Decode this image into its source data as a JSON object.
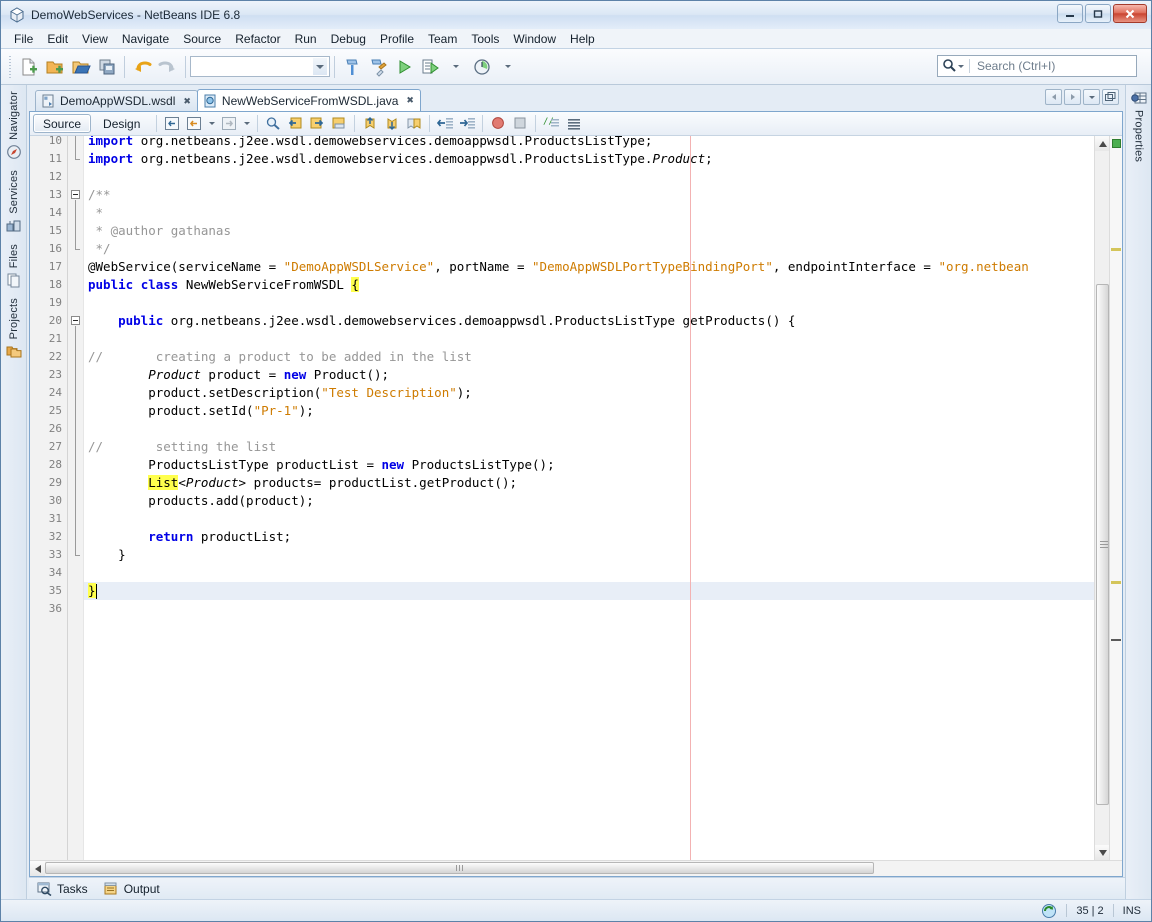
{
  "window": {
    "title": "DemoWebServices - NetBeans IDE 6.8",
    "icon": "netbeans-cube-icon",
    "controls": {
      "minimize": "–",
      "maximize": "❐",
      "close": "✕"
    }
  },
  "menubar": {
    "items": [
      {
        "label": "File"
      },
      {
        "label": "Edit"
      },
      {
        "label": "View"
      },
      {
        "label": "Navigate"
      },
      {
        "label": "Source"
      },
      {
        "label": "Refactor"
      },
      {
        "label": "Run"
      },
      {
        "label": "Debug"
      },
      {
        "label": "Profile"
      },
      {
        "label": "Team"
      },
      {
        "label": "Tools"
      },
      {
        "label": "Window"
      },
      {
        "label": "Help"
      }
    ]
  },
  "toolbar": {
    "buttons": [
      {
        "name": "new-file-button",
        "icon": "new-file-icon"
      },
      {
        "name": "new-project-button",
        "icon": "new-project-icon"
      },
      {
        "name": "open-project-button",
        "icon": "open-project-icon"
      },
      {
        "name": "save-all-button",
        "icon": "save-all-icon"
      },
      {
        "name": "undo-button",
        "icon": "undo-arrow-icon"
      },
      {
        "name": "redo-button",
        "icon": "redo-arrow-icon"
      }
    ],
    "config_combo": {
      "value": "",
      "name": "configuration-combo"
    },
    "right_buttons": [
      {
        "name": "build-project-button",
        "icon": "hammer-icon"
      },
      {
        "name": "clean-and-build-button",
        "icon": "hammer-broom-icon"
      },
      {
        "name": "run-project-button",
        "icon": "green-play-icon"
      },
      {
        "name": "debug-project-button",
        "icon": "debug-icon"
      },
      {
        "name": "profile-project-button",
        "icon": "profile-clock-icon"
      }
    ]
  },
  "search": {
    "placeholder": "Search (Ctrl+I)",
    "value": "",
    "icon": "search-magnifier-icon"
  },
  "left_rail": {
    "tabs": [
      {
        "label": "Navigator",
        "icon": "navigator-compass-icon"
      },
      {
        "label": "Services",
        "icon": "services-server-icon"
      },
      {
        "label": "Files",
        "icon": "files-pages-icon"
      },
      {
        "label": "Projects",
        "icon": "projects-folder-icon"
      }
    ]
  },
  "right_rail": {
    "tabs": [
      {
        "label": "Properties",
        "icon": "properties-grid-icon"
      }
    ]
  },
  "document_tabs": {
    "tabs": [
      {
        "label": "DemoAppWSDL.wsdl",
        "icon": "wsdl-file-icon",
        "active": false,
        "close": "✖"
      },
      {
        "label": "NewWebServiceFromWSDL.java",
        "icon": "java-file-icon",
        "active": true,
        "close": "✖"
      }
    ],
    "nav": [
      {
        "name": "scroll-tabs-left-button",
        "icon": "chevron-left-icon"
      },
      {
        "name": "scroll-tabs-right-button",
        "icon": "chevron-right-icon"
      },
      {
        "name": "show-opened-documents-button",
        "icon": "chevron-down-icon"
      },
      {
        "name": "maximize-window-button",
        "icon": "maximize-window-icon"
      }
    ]
  },
  "editor_toolbar": {
    "view_buttons": [
      {
        "label": "Source",
        "selected": true
      },
      {
        "label": "Design",
        "selected": false
      }
    ],
    "action_buttons": [
      {
        "name": "last-edit-button",
        "icon": "last-edit-icon"
      },
      {
        "name": "back-button",
        "icon": "back-arrow-icon"
      },
      {
        "name": "back-dropdown",
        "icon": "chevron-down-icon"
      },
      {
        "name": "forward-button",
        "icon": "forward-arrow-icon"
      },
      {
        "name": "forward-dropdown",
        "icon": "chevron-down-icon"
      },
      {
        "name": "find-selection-button",
        "icon": "find-magnifier-icon"
      },
      {
        "name": "find-previous-button",
        "icon": "find-previous-icon"
      },
      {
        "name": "find-next-button",
        "icon": "find-next-icon"
      },
      {
        "name": "toggle-highlight-button",
        "icon": "toggle-highlight-icon"
      },
      {
        "name": "previous-bookmark-button",
        "icon": "previous-bookmark-icon"
      },
      {
        "name": "next-bookmark-button",
        "icon": "next-bookmark-icon"
      },
      {
        "name": "toggle-bookmark-button",
        "icon": "toggle-bookmark-icon"
      },
      {
        "name": "shift-left-button",
        "icon": "shift-left-icon"
      },
      {
        "name": "shift-right-button",
        "icon": "shift-right-icon"
      },
      {
        "name": "start-macro-recording-button",
        "icon": "record-macro-icon"
      },
      {
        "name": "stop-macro-recording-button",
        "icon": "stop-macro-icon"
      },
      {
        "name": "comment-button",
        "icon": "comment-icon"
      },
      {
        "name": "uncomment-button",
        "icon": "uncomment-icon"
      }
    ]
  },
  "editor": {
    "first_visible_line": 10,
    "caret": {
      "line": 35,
      "column": 2
    },
    "right_margin_column": 80,
    "lines": [
      {
        "n": 10,
        "tokens": [
          {
            "t": "import ",
            "c": "kw"
          },
          {
            "t": "org.netbeans.j2ee.wsdl.demowebservices.demoappwsdl.ProductsListType;",
            "c": ""
          }
        ],
        "indent": 0,
        "clipped_top": true
      },
      {
        "n": 11,
        "tokens": [
          {
            "t": "import ",
            "c": "kw"
          },
          {
            "t": "org.netbeans.j2ee.wsdl.demowebservices.demoappwsdl.ProductsListType.",
            "c": ""
          },
          {
            "t": "Product",
            "c": "typ"
          },
          {
            "t": ";",
            "c": ""
          }
        ],
        "indent": 0
      },
      {
        "n": 12,
        "tokens": [],
        "indent": 0
      },
      {
        "n": 13,
        "tokens": [
          {
            "t": "/**",
            "c": "cmt"
          }
        ],
        "indent": 0
      },
      {
        "n": 14,
        "tokens": [
          {
            "t": " *",
            "c": "cmt"
          }
        ],
        "indent": 0
      },
      {
        "n": 15,
        "tokens": [
          {
            "t": " * @author gathanas",
            "c": "cmt"
          }
        ],
        "indent": 0
      },
      {
        "n": 16,
        "tokens": [
          {
            "t": " */",
            "c": "cmt"
          }
        ],
        "indent": 0
      },
      {
        "n": 17,
        "tokens": [
          {
            "t": "@WebService(serviceName = ",
            "c": ""
          },
          {
            "t": "\"DemoAppWSDLService\"",
            "c": "str"
          },
          {
            "t": ", portName = ",
            "c": ""
          },
          {
            "t": "\"DemoAppWSDLPortTypeBindingPort\"",
            "c": "str"
          },
          {
            "t": ", endpointInterface = ",
            "c": ""
          },
          {
            "t": "\"org.netbean",
            "c": "str"
          }
        ],
        "indent": 0
      },
      {
        "n": 18,
        "tokens": [
          {
            "t": "public ",
            "c": "kw"
          },
          {
            "t": "class ",
            "c": "kw"
          },
          {
            "t": "NewWebServiceFromWSDL ",
            "c": ""
          },
          {
            "t": "{",
            "c": "hl"
          }
        ],
        "indent": 0
      },
      {
        "n": 19,
        "tokens": [],
        "indent": 0
      },
      {
        "n": 20,
        "tokens": [
          {
            "t": "    ",
            "c": ""
          },
          {
            "t": "public ",
            "c": "kw"
          },
          {
            "t": "org.netbeans.j2ee.wsdl.demowebservices.demoappwsdl.ProductsListType getProducts() {",
            "c": ""
          }
        ],
        "indent": 0
      },
      {
        "n": 21,
        "tokens": [],
        "indent": 0
      },
      {
        "n": 22,
        "tokens": [
          {
            "t": "//       creating a product to be added in the list",
            "c": "cmt"
          }
        ],
        "indent": 0
      },
      {
        "n": 23,
        "tokens": [
          {
            "t": "        ",
            "c": ""
          },
          {
            "t": "Product",
            "c": "typ"
          },
          {
            "t": " product = ",
            "c": ""
          },
          {
            "t": "new",
            "c": "kw"
          },
          {
            "t": " Product();",
            "c": ""
          }
        ],
        "indent": 0
      },
      {
        "n": 24,
        "tokens": [
          {
            "t": "        product.setDescription(",
            "c": ""
          },
          {
            "t": "\"Test Description\"",
            "c": "str"
          },
          {
            "t": ");",
            "c": ""
          }
        ],
        "indent": 0
      },
      {
        "n": 25,
        "tokens": [
          {
            "t": "        product.setId(",
            "c": ""
          },
          {
            "t": "\"Pr-1\"",
            "c": "str"
          },
          {
            "t": ");",
            "c": ""
          }
        ],
        "indent": 0
      },
      {
        "n": 26,
        "tokens": [],
        "indent": 0
      },
      {
        "n": 27,
        "tokens": [
          {
            "t": "//       setting the list",
            "c": "cmt"
          }
        ],
        "indent": 0
      },
      {
        "n": 28,
        "tokens": [
          {
            "t": "        ProductsListType productList = ",
            "c": ""
          },
          {
            "t": "new",
            "c": "kw"
          },
          {
            "t": " ProductsListType();",
            "c": ""
          }
        ],
        "indent": 0
      },
      {
        "n": 29,
        "tokens": [
          {
            "t": "        ",
            "c": ""
          },
          {
            "t": "List",
            "c": "hl"
          },
          {
            "t": "<",
            "c": ""
          },
          {
            "t": "Product",
            "c": "typ"
          },
          {
            "t": "> products= productList.getProduct();",
            "c": ""
          }
        ],
        "indent": 0
      },
      {
        "n": 30,
        "tokens": [
          {
            "t": "        products.add(product);",
            "c": ""
          }
        ],
        "indent": 0
      },
      {
        "n": 31,
        "tokens": [],
        "indent": 0
      },
      {
        "n": 32,
        "tokens": [
          {
            "t": "        ",
            "c": ""
          },
          {
            "t": "return",
            "c": "kw"
          },
          {
            "t": " productList;",
            "c": ""
          }
        ],
        "indent": 0
      },
      {
        "n": 33,
        "tokens": [
          {
            "t": "    }",
            "c": ""
          }
        ],
        "indent": 0
      },
      {
        "n": 34,
        "tokens": [],
        "indent": 0
      },
      {
        "n": 35,
        "tokens": [
          {
            "t": "}",
            "c": "hl"
          }
        ],
        "indent": 0,
        "current": true
      },
      {
        "n": 36,
        "tokens": [],
        "indent": 0
      }
    ]
  },
  "annotations": {
    "ok_marker_color": "#4caf50",
    "warning_marker_color": "#d4c55a",
    "caret_marker_color": "#5a5a5a"
  },
  "bottom_dock": {
    "tabs": [
      {
        "label": "Tasks",
        "icon": "tasks-icon"
      },
      {
        "label": "Output",
        "icon": "output-icon"
      }
    ]
  },
  "statusbar": {
    "icon": "refresh-scan-icon",
    "position": "35 | 2",
    "insert_mode": "INS"
  }
}
